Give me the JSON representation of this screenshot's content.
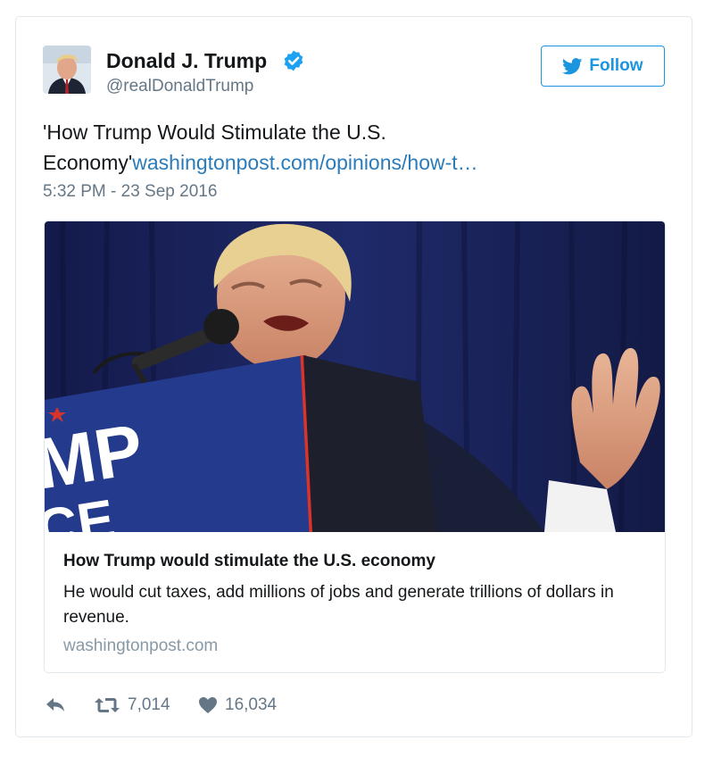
{
  "author": {
    "name": "Donald J. Trump",
    "handle": "@realDonaldTrump",
    "verified": true
  },
  "follow_button": {
    "label": "Follow"
  },
  "tweet": {
    "text_line1": "'How Trump Would Stimulate the U.S.",
    "text_line2_prefix": "Economy'",
    "link_text": "washingtonpost.com/opinions/how-t…",
    "timestamp": "5:32 PM - 23 Sep 2016"
  },
  "card": {
    "image_sign_letters": "MP",
    "image_sign_letters_2": "CE",
    "title": "How Trump would stimulate the U.S. economy",
    "description": "He would cut taxes, add millions of jobs and generate trillions of dollars in revenue.",
    "domain": "washingtonpost.com"
  },
  "actions": {
    "reply_icon": "reply-icon",
    "retweet_icon": "retweet-icon",
    "retweet_count": "7,014",
    "like_icon": "heart-icon",
    "like_count": "16,034"
  },
  "colors": {
    "link": "#2b7bb9",
    "follow": "#1b95e0",
    "verified": "#1da1f2",
    "muted": "#657786",
    "sign_blue": "#243a8c",
    "sign_red": "#d8342b"
  }
}
